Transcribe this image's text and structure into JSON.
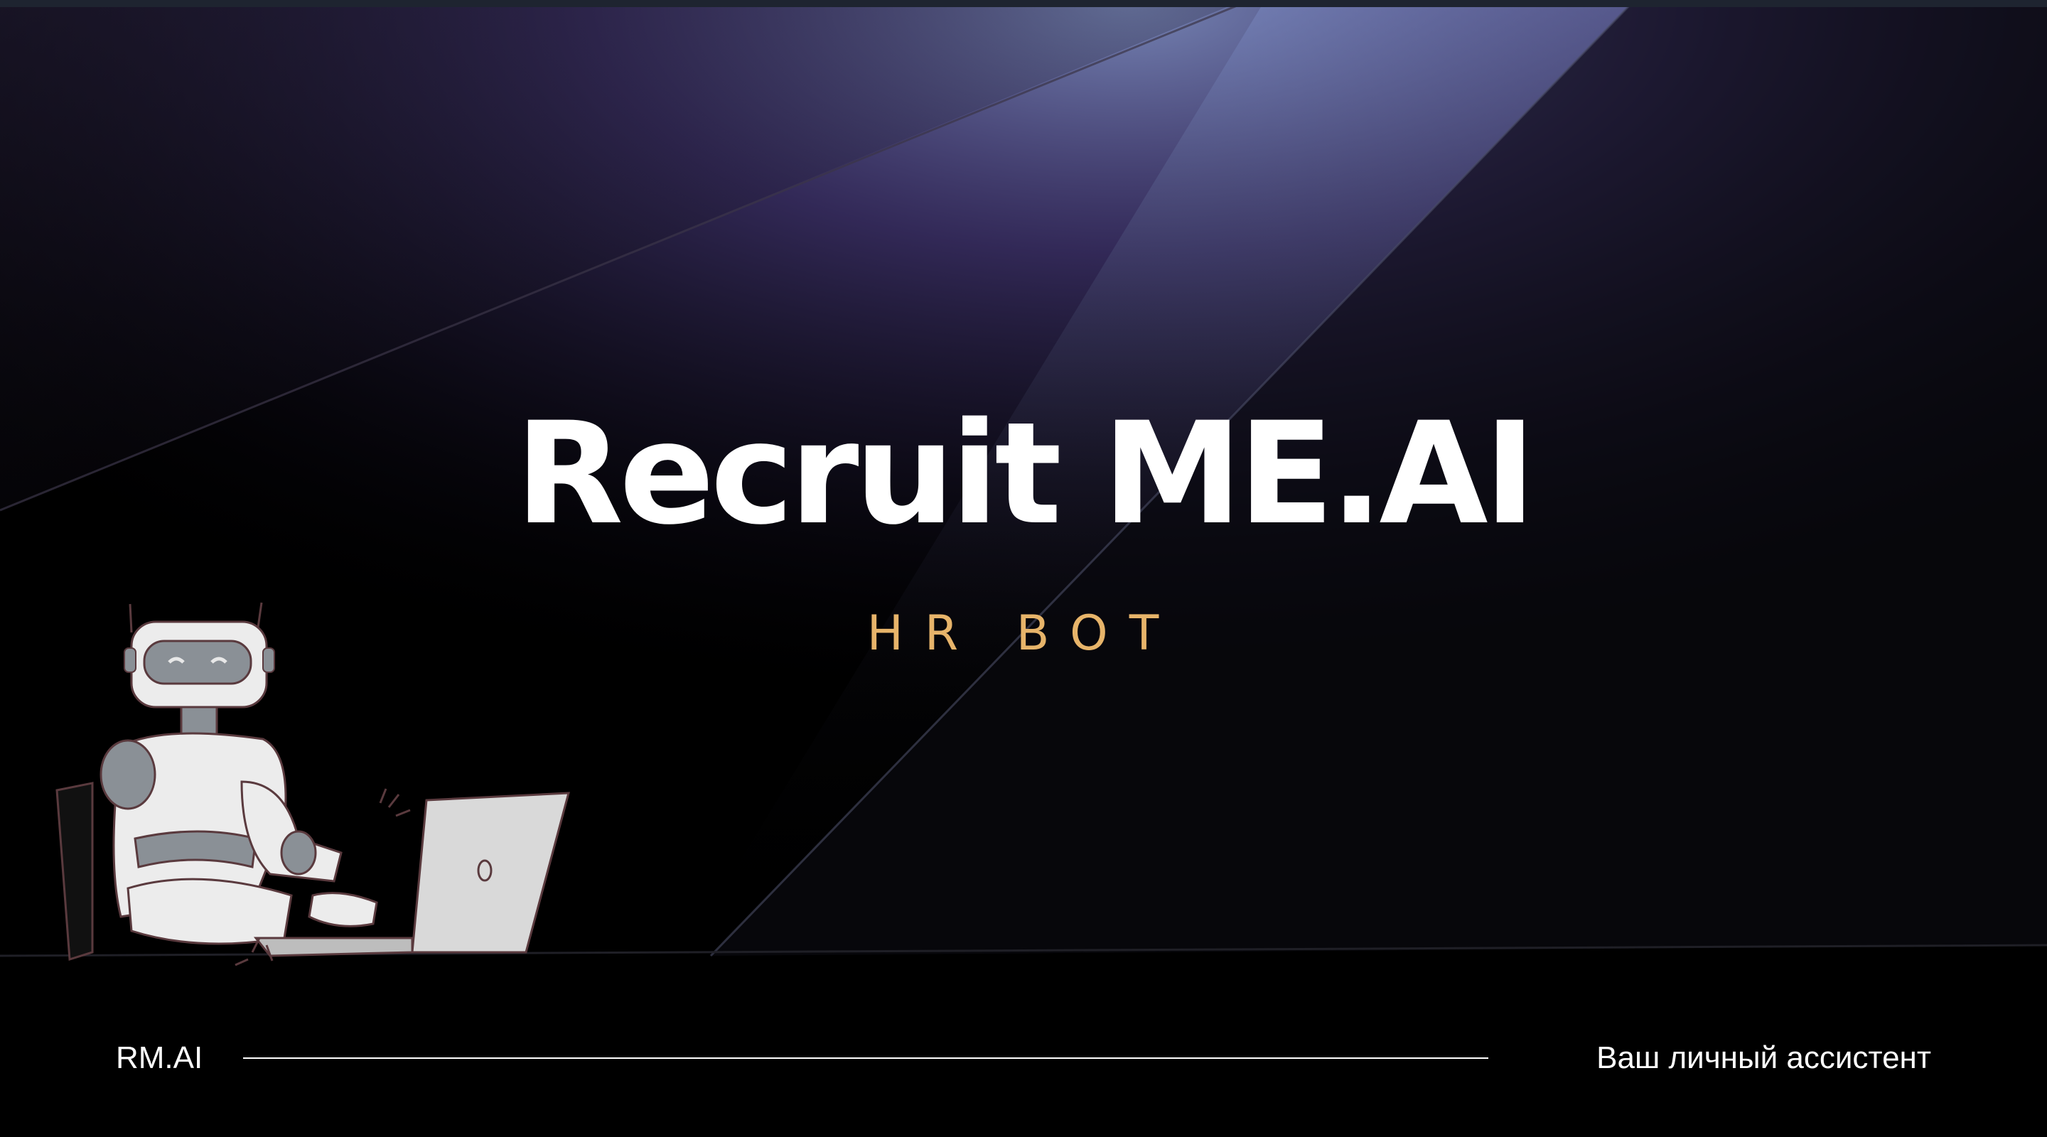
{
  "slide": {
    "title": "Recruit ME.AI",
    "subtitle": "HR BOT"
  },
  "footer": {
    "brand": "RM.AI",
    "tagline": "Ваш личный ассистент"
  },
  "colors": {
    "background": "#000000",
    "accent_gold": "#e7b46a",
    "glow_purple": "#6a4fb8",
    "glow_blue": "#8c9ed6",
    "text": "#ffffff"
  },
  "icons": [
    "robot-at-laptop-illustration"
  ]
}
